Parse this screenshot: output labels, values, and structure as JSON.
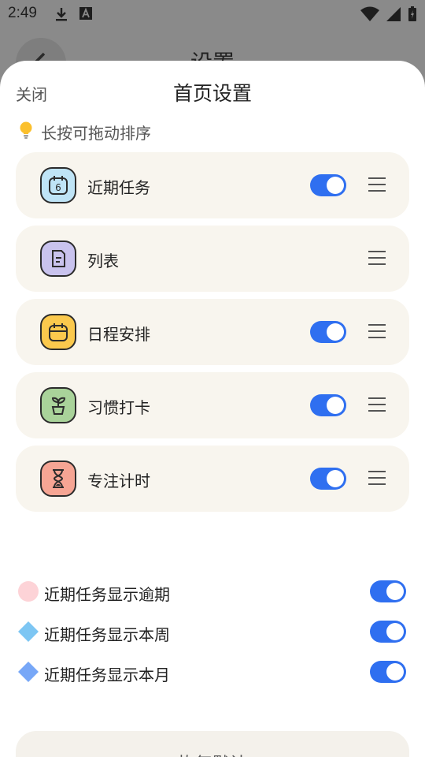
{
  "status_bar": {
    "time": "2:49"
  },
  "background": {
    "title": "设置"
  },
  "sheet": {
    "close_label": "关闭",
    "title": "首页设置",
    "hint": "长按可拖动排序"
  },
  "modules": [
    {
      "label": "近期任务",
      "icon": "calendar-6-icon",
      "color": "#bfe4f6",
      "toggle": true
    },
    {
      "label": "列表",
      "icon": "list-doc-icon",
      "color": "#c9c3ee",
      "toggle": false
    },
    {
      "label": "日程安排",
      "icon": "calendar-icon",
      "color": "#fbc94d",
      "toggle": true
    },
    {
      "label": "习惯打卡",
      "icon": "sprout-icon",
      "color": "#a9d39a",
      "toggle": true
    },
    {
      "label": "专注计时",
      "icon": "hourglass-icon",
      "color": "#f6a594",
      "toggle": true
    }
  ],
  "options": [
    {
      "label": "近期任务显示逾期",
      "color": "#fdd3d7",
      "enabled": true
    },
    {
      "label": "近期任务显示本周",
      "color": "#7dc6f3",
      "enabled": true
    },
    {
      "label": "近期任务显示本月",
      "color": "#77a7f7",
      "enabled": true
    }
  ],
  "reset_label": "恢复默认",
  "colors": {
    "accent": "#2f6ff0",
    "card": "#f8f5ee"
  }
}
